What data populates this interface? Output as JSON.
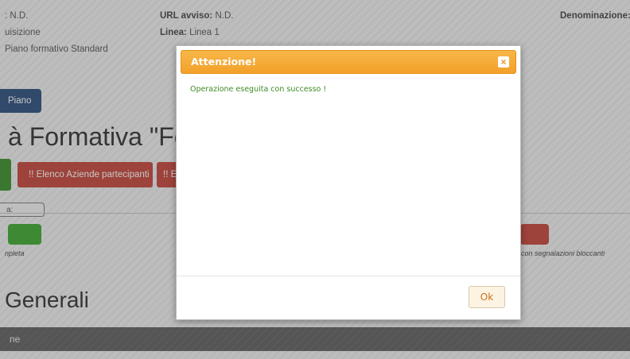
{
  "info": {
    "col1_row1": ": N.D.",
    "col1_row2": "uisizione",
    "col1_row3": "Piano formativo Standard",
    "url_label": "URL avviso:",
    "url_value": " N.D.",
    "linea_label": "Linea:",
    "linea_value": " Linea 1",
    "denominazione_label": "Denominazione:"
  },
  "page": {
    "piano_button": "Piano",
    "title": "à Formativa \"Fo",
    "elenco_aziende": "!!  Elenco Aziende partecipanti",
    "second_red": "!!  E",
    "small_box": "a:",
    "completa": "npleta",
    "bloccanti": "con segnalazioni bloccanti",
    "section_title": "Generali",
    "bar_label": "ne"
  },
  "modal": {
    "title": "Attenzione!",
    "close": "×",
    "message": "Operazione eseguita con successo !",
    "ok_label": "Ok"
  }
}
